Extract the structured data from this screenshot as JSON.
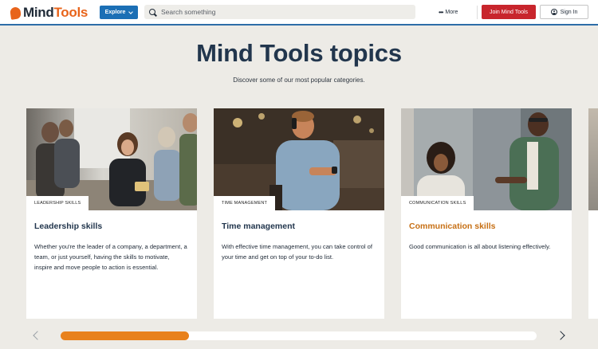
{
  "header": {
    "logo": {
      "text_main": "Mind",
      "text_accent": "Tools"
    },
    "explore_label": "Explore",
    "search": {
      "placeholder": "Search something"
    },
    "more_label": "More",
    "join_label": "Join Mind Tools",
    "signin_label": "Sign In"
  },
  "main": {
    "title": "Mind Tools topics",
    "subtitle": "Discover some of our most popular categories.",
    "cards": [
      {
        "badge": "LEADERSHIP SKILLS",
        "title": "Leadership skills",
        "description": "Whether you're the leader of a company, a department, a team, or just yourself, having the skills to motivate, inspire and move people to action is essential."
      },
      {
        "badge": "TIME MANAGEMENT",
        "title": "Time management",
        "description": "With effective time management, you can take control of your time and get on top of your to-do list."
      },
      {
        "badge": "COMMUNICATION SKILLS",
        "title": "Communication skills",
        "description": "Good communication is all about listening effectively."
      }
    ],
    "carousel": {
      "progress_fraction": 0.27
    }
  },
  "colors": {
    "brand_orange": "#e8641b",
    "explore_blue": "#1b6fb5",
    "join_red": "#c8252c",
    "title_navy": "#22364d",
    "highlight_orange": "#c66f14",
    "progress_orange": "#e8811c"
  },
  "icons": [
    "search-icon",
    "chevron-down-icon",
    "more-dots-icon",
    "user-icon",
    "arrow-left-icon",
    "arrow-right-icon"
  ]
}
